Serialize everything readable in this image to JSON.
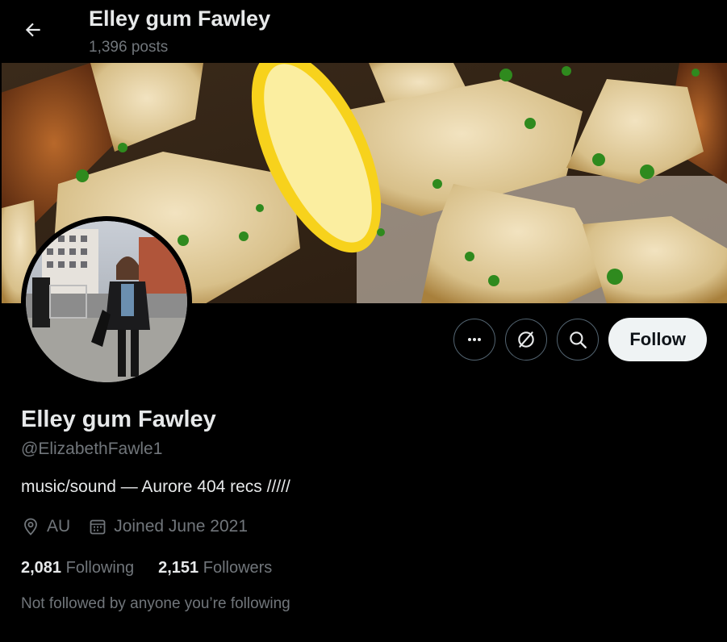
{
  "header": {
    "title": "Elley gum Fawley",
    "post_count": "1,396 posts"
  },
  "banner": {
    "subject": "roasted potatoes with lemon slice and parsley"
  },
  "avatar": {
    "subject": "profile photo of person on a street"
  },
  "actions": {
    "more_icon": "more-horizontal-icon",
    "grok_icon": "slash-circle-icon",
    "search_icon": "search-icon",
    "follow_label": "Follow"
  },
  "profile": {
    "name": "Elley gum Fawley",
    "handle": "@ElizabethFawle1",
    "bio": "music/sound — Aurore 404 recs /////",
    "location": "AU",
    "joined": "Joined June 2021",
    "following_count": "2,081",
    "following_label": "Following",
    "followers_count": "2,151",
    "followers_label": "Followers",
    "mutuals_note": "Not followed by anyone you’re following"
  },
  "colors": {
    "background": "#000000",
    "text_primary": "#e7e9ea",
    "text_secondary": "#71767b",
    "follow_button_bg": "#eff3f4",
    "button_border": "#536471"
  }
}
